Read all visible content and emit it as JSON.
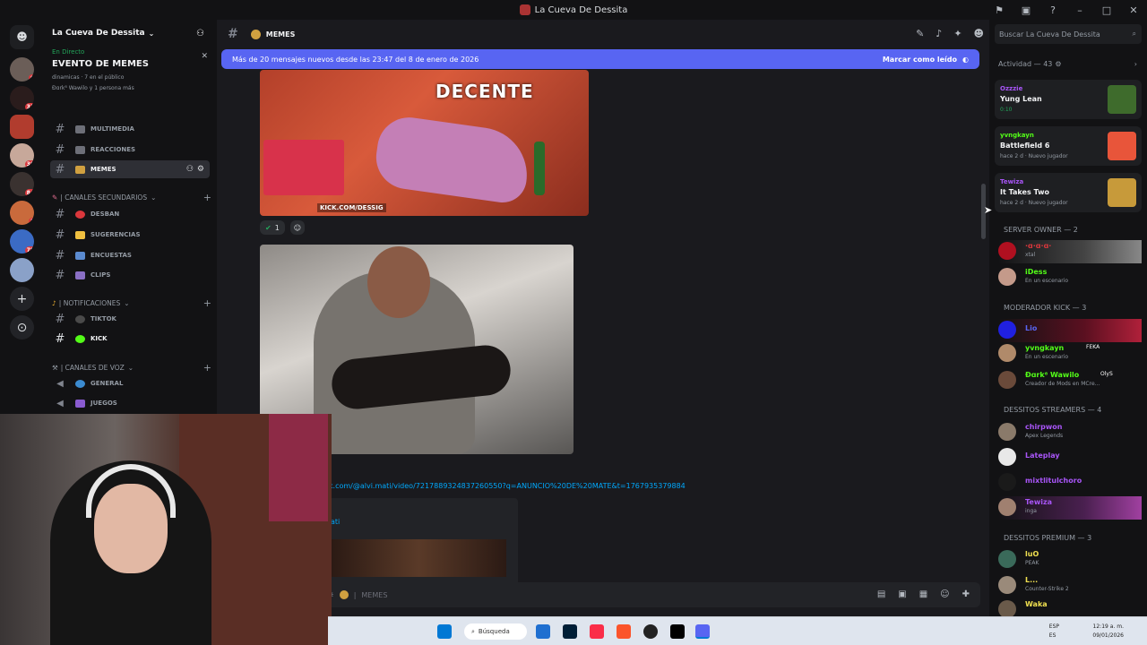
{
  "window": {
    "title": "La Cueva De Dessita"
  },
  "server": {
    "name": "La Cueva De Dessita"
  },
  "server_badges": [
    "6",
    "31",
    "30",
    "84",
    "1",
    "78"
  ],
  "event": {
    "live_label": "En Directo",
    "title": "EVENTO DE MEMES",
    "sub1": "dinamicas · 7 en el público",
    "sub2": "Ðɑrk⁸ Wawilo y 1 persona más"
  },
  "channels": {
    "multimedia": "MULTIMEDIA",
    "reacciones": "REACCIONES",
    "memes": "MEMES",
    "cat_secundarios": "| CANALES SECUNDARIOS",
    "desban": "DESBAN",
    "sugerencias": "SUGERENCIAS",
    "encuestas": "ENCUESTAS",
    "clips": "CLIPS",
    "cat_notificaciones": "| NOTIFICACIONES",
    "tiktok": "TIKTOK",
    "kick": "KICK",
    "cat_voz": "| CANALES DE VOZ",
    "general": "GENERAL",
    "juegos": "JUEGOS"
  },
  "chat": {
    "channel_name": "MEMES",
    "banner_text": "Más de 20 mensajes nuevos desde las 23:47 del 8 de enero de 2026",
    "banner_action": "Marcar como leído",
    "meme_caption": "DECENTE",
    "meme_watermark": "KICK.COM/DESSIG",
    "reaction_count": "1",
    "link": "ok.com/@alvi.mati/video/7217889324837260550?q=ANUNCIO%20DE%20MATE&t=1767935379884",
    "embed_name": "ati",
    "composer_placeholder": "MEMES"
  },
  "search": {
    "placeholder": "Buscar La Cueva De Dessita"
  },
  "activity": {
    "header": "Actividad — 43",
    "items": [
      {
        "name": "Ozzzie",
        "game": "Yung Lean",
        "status": "0:10"
      },
      {
        "name": "yvngkayn",
        "game": "Battlefield 6",
        "status": "hace 2 d · Nuevo jugador"
      },
      {
        "name": "Tewiza",
        "game": "It Takes Two",
        "status": "hace 2 d · Nuevo jugador"
      }
    ]
  },
  "roles": {
    "owner": "SERVER OWNER — 2",
    "mod": "MODERADOR KICK — 3",
    "streamers": "DESSITOS STREAMERS — 4",
    "premium": "DESSITOS PREMIUM — 3"
  },
  "members": {
    "owner1": {
      "name": "·ɑ·ɑ·ɑ·",
      "status": "xtal"
    },
    "idess": {
      "name": "iDess",
      "status": "En un escenario"
    },
    "lio": {
      "name": "Lio"
    },
    "yvngkayn": {
      "name": "yvngkayn",
      "status": "En un escenario",
      "tag": "FEKA"
    },
    "dark": {
      "name": "Ðɑrk⁸ Wawilo",
      "status": "Creador de Mods en MCre...",
      "tag": "OlyS"
    },
    "chirpwon": {
      "name": "chirpwon",
      "status": "Apex Legends"
    },
    "lateplay": {
      "name": "Lateplay"
    },
    "mixtli": {
      "name": "mixtlitulchoro"
    },
    "tewiza": {
      "name": "Tewiza",
      "status": "inga"
    },
    "luo": {
      "name": "luO",
      "status": "PEAK"
    },
    "l": {
      "name": "L...",
      "status": "Counter-Strike 2"
    },
    "waka": {
      "name": "Waka"
    }
  },
  "taskbar": {
    "search": "Búsqueda",
    "lang1": "ESP",
    "lang2": "ES",
    "time": "12:19 a. m.",
    "date": "09/01/2026"
  },
  "colors": {
    "accent": "#5865f2",
    "online": "#23a55a",
    "link": "#00a8fc"
  }
}
